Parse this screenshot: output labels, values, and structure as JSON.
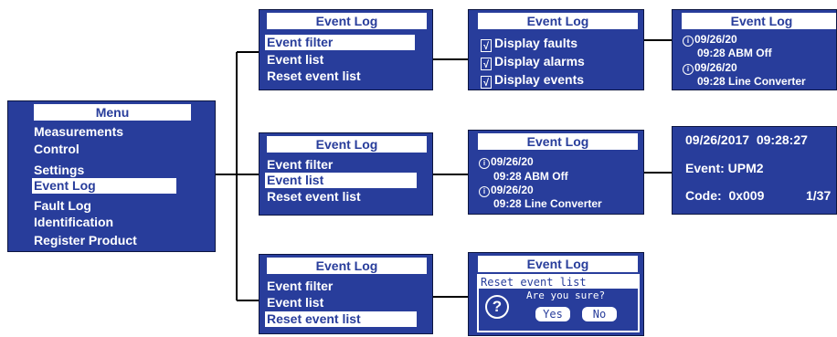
{
  "colors": {
    "panel": "#283d9b",
    "highlight": "#ffffff",
    "connector": "#000000"
  },
  "menu": {
    "title": "Menu",
    "items": [
      "Measurements",
      "Control",
      "Settings",
      "Event Log",
      "Fault Log",
      "Identification",
      "Register Product"
    ],
    "selected": "Event Log"
  },
  "event_log_filter": {
    "title": "Event Log",
    "items": [
      "Event filter",
      "Event list",
      "Reset event list"
    ],
    "selected": "Event filter"
  },
  "event_log_list": {
    "title": "Event Log",
    "items": [
      "Event filter",
      "Event list",
      "Reset event list"
    ],
    "selected": "Event list"
  },
  "event_log_reset": {
    "title": "Event Log",
    "items": [
      "Event filter",
      "Event list",
      "Reset event list"
    ],
    "selected": "Reset event list"
  },
  "filter_options": {
    "title": "Event Log",
    "options": [
      {
        "label": "Display faults",
        "check": "√"
      },
      {
        "label": "Display alarms",
        "check": "√"
      },
      {
        "label": "Display events",
        "check": "√"
      }
    ]
  },
  "filtered_events": {
    "title": "Event Log",
    "events": [
      {
        "date": "09/26/20",
        "time_desc": "09:28  ABM Off"
      },
      {
        "date": "09/26/20",
        "time_desc": "09:28  Line Converter"
      }
    ]
  },
  "event_list_view": {
    "title": "Event Log",
    "events": [
      {
        "date": "09/26/20",
        "time_desc": "09:28  ABM Off"
      },
      {
        "date": "09/26/20",
        "time_desc": "09:28  Line Converter"
      }
    ]
  },
  "event_detail": {
    "datetime": "09/26/2017  09:28:27",
    "event": "Event: UPM2",
    "code": "Code:  0x009",
    "position": "1/37"
  },
  "reset_dialog": {
    "title": "Event Log",
    "prompt": "Reset event list",
    "question": "Are you sure?",
    "question_icon": "?",
    "yes": "Yes",
    "no": "No"
  },
  "icons": {
    "info": "i",
    "scroll_up": "up-arrow-icon",
    "scroll_down": "down-arrow-icon"
  }
}
